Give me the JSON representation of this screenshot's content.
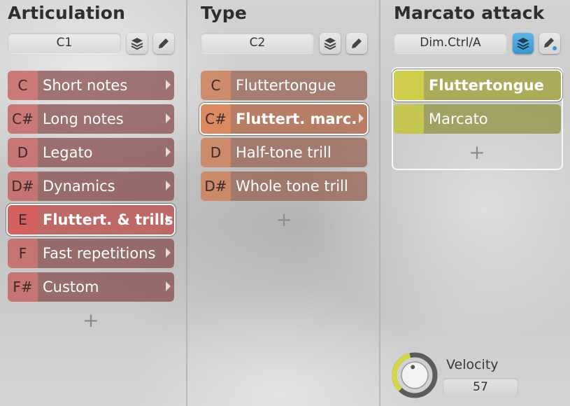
{
  "columns": [
    {
      "title": "Articulation",
      "field_value": "C1",
      "rows": [
        {
          "key": "C",
          "label": "Short notes"
        },
        {
          "key": "C#",
          "label": "Long notes"
        },
        {
          "key": "D",
          "label": "Legato"
        },
        {
          "key": "D#",
          "label": "Dynamics"
        },
        {
          "key": "E",
          "label": "Fluttert. & trills"
        },
        {
          "key": "F",
          "label": "Fast repetitions"
        },
        {
          "key": "F#",
          "label": "Custom"
        }
      ],
      "add_label": "+"
    },
    {
      "title": "Type",
      "field_value": "C2",
      "rows": [
        {
          "key": "C",
          "label": "Fluttertongue"
        },
        {
          "key": "C#",
          "label": "Fluttert. marc."
        },
        {
          "key": "D",
          "label": "Half-tone trill"
        },
        {
          "key": "D#",
          "label": "Whole tone trill"
        }
      ],
      "add_label": "+"
    },
    {
      "title": "Marcato attack",
      "field_value": "Dim.Ctrl/A",
      "rows": [
        {
          "key": "",
          "label": "Fluttertongue"
        },
        {
          "key": "",
          "label": "Marcato"
        }
      ],
      "add_label": "+"
    }
  ],
  "velocity": {
    "label": "Velocity",
    "value": "57",
    "level": 0.45
  },
  "icons": {
    "layers": "layers-icon",
    "edit": "pencil-icon"
  },
  "colors": {
    "articulation": "#c65c5c",
    "type": "#ce805c",
    "attack": "#c4c448",
    "accent": "#3a96d2",
    "knob_arc": "#d6d645"
  }
}
